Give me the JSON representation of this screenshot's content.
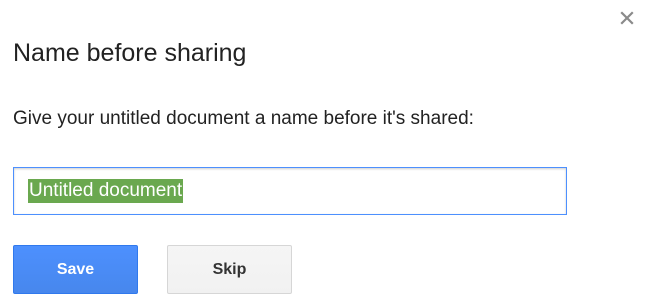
{
  "dialog": {
    "title": "Name before sharing",
    "prompt": "Give your untitled document a name before it's shared:",
    "close_icon": "close-icon",
    "name_input": {
      "value": "Untitled document"
    },
    "buttons": {
      "save_label": "Save",
      "skip_label": "Skip"
    }
  },
  "colors": {
    "primary_button": "#4d90fe",
    "focus_border": "#4d90fe",
    "selection_highlight": "#6aa84f",
    "secondary_button": "#f3f3f3"
  }
}
